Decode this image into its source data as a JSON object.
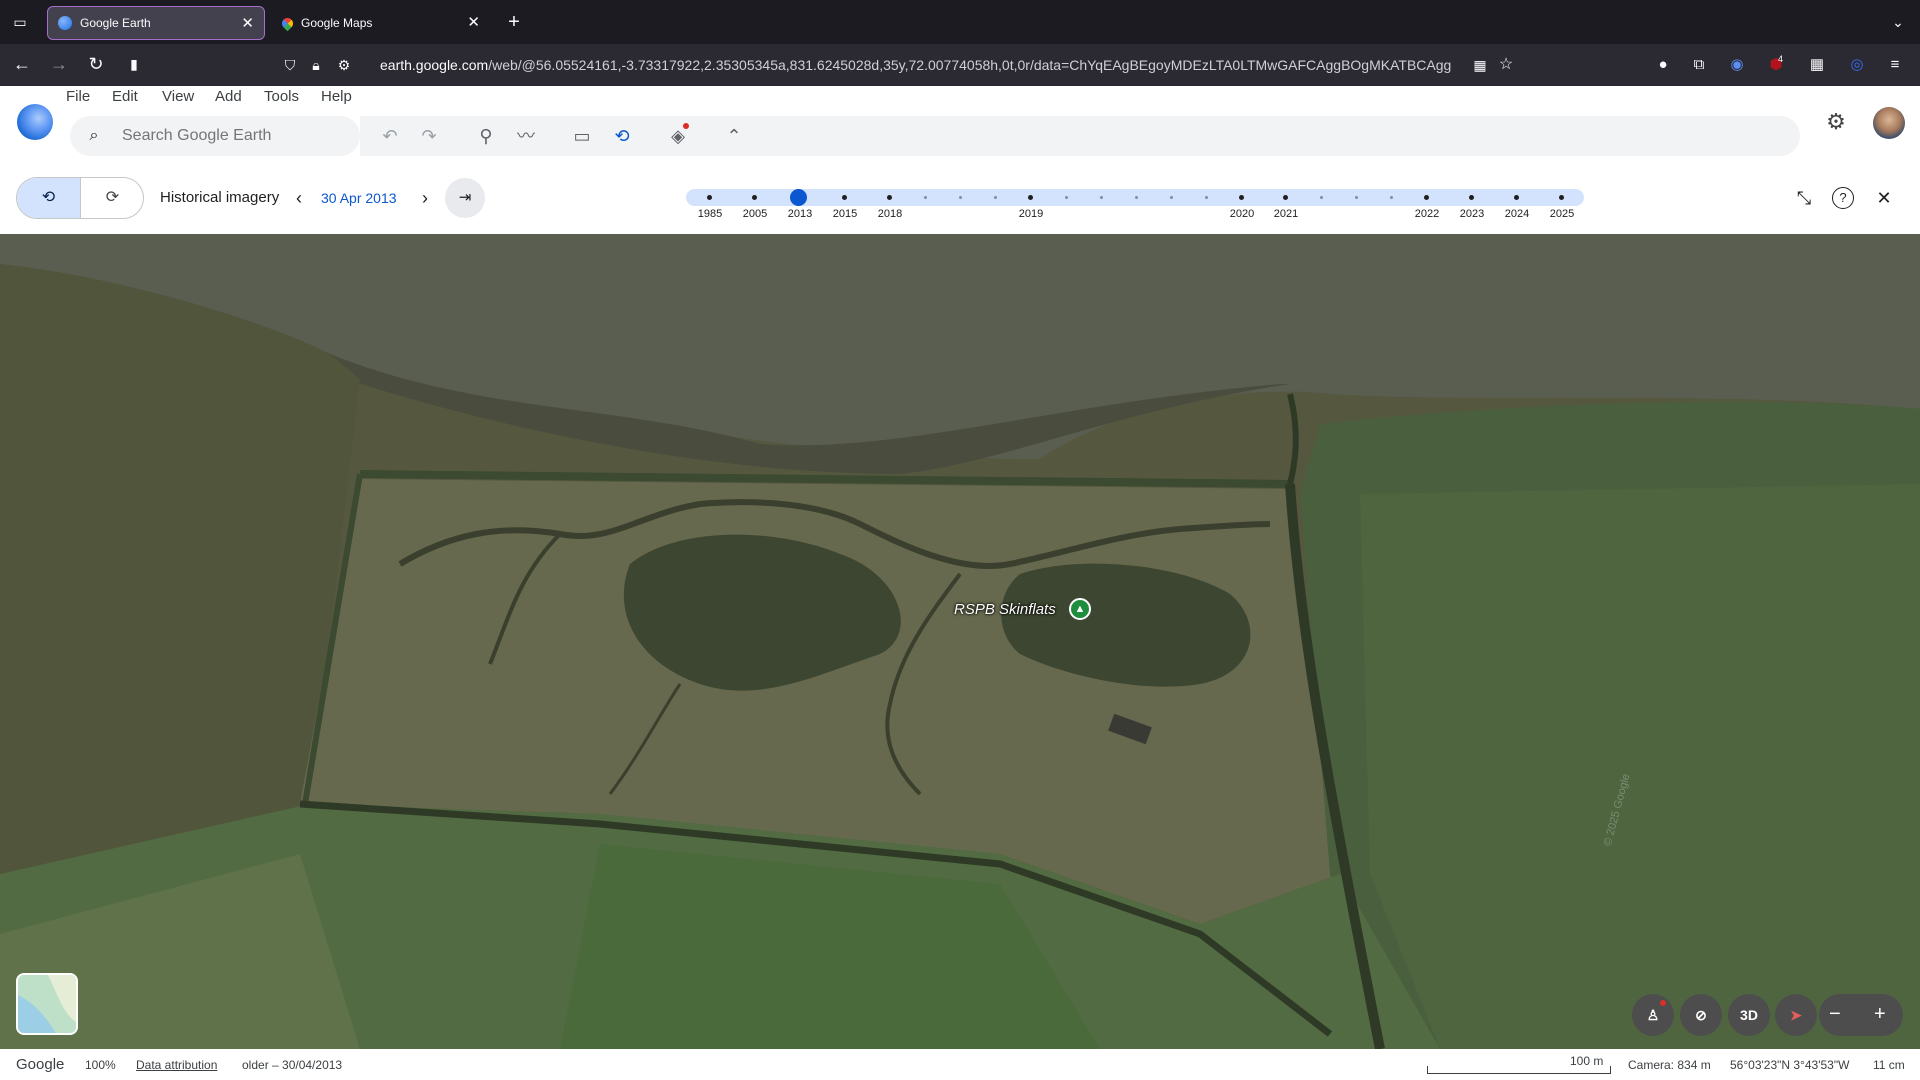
{
  "browser": {
    "tabs": [
      {
        "title": "Google Earth",
        "active": true
      },
      {
        "title": "Google Maps",
        "active": false
      }
    ],
    "url_host": "earth.google.com",
    "url_rest": "/web/@56.05524161,-3.73317922,2.35305345a,831.6245028d,35y,72.00774058h,0t,0r/data=ChYqEAgBEgoyMDEzLTA0LTMwGAFCAggBOgMKATBCAgg",
    "extension_badge": "4"
  },
  "menu": [
    "File",
    "Edit",
    "View",
    "Add",
    "Tools",
    "Help"
  ],
  "search": {
    "placeholder": "Search Google Earth"
  },
  "historical": {
    "label": "Historical imagery",
    "date": "30 Apr 2013",
    "selected_year": "2013",
    "years": [
      "1985",
      "2005",
      "2013",
      "2015",
      "2018",
      "2019",
      "2020",
      "2021",
      "2022",
      "2023",
      "2024",
      "2025"
    ]
  },
  "map": {
    "place_label": "RSPB Skinflats",
    "watermark": "© 2025 Google"
  },
  "controls": {
    "three_d": "3D"
  },
  "status": {
    "brand": "Google",
    "zoom": "100%",
    "attribution": "Data attribution",
    "imagery_date": "older – 30/04/2013",
    "scale": "100 m",
    "camera": "Camera: 834 m",
    "coords": "56°03'23\"N 3°43'53\"W",
    "resolution": "11 cm"
  },
  "colors": {
    "accent": "#0b57d0",
    "timeline": "#d3e3fd",
    "browser_bg": "#1c1b22",
    "tab_active_border": "#a56ecb"
  }
}
